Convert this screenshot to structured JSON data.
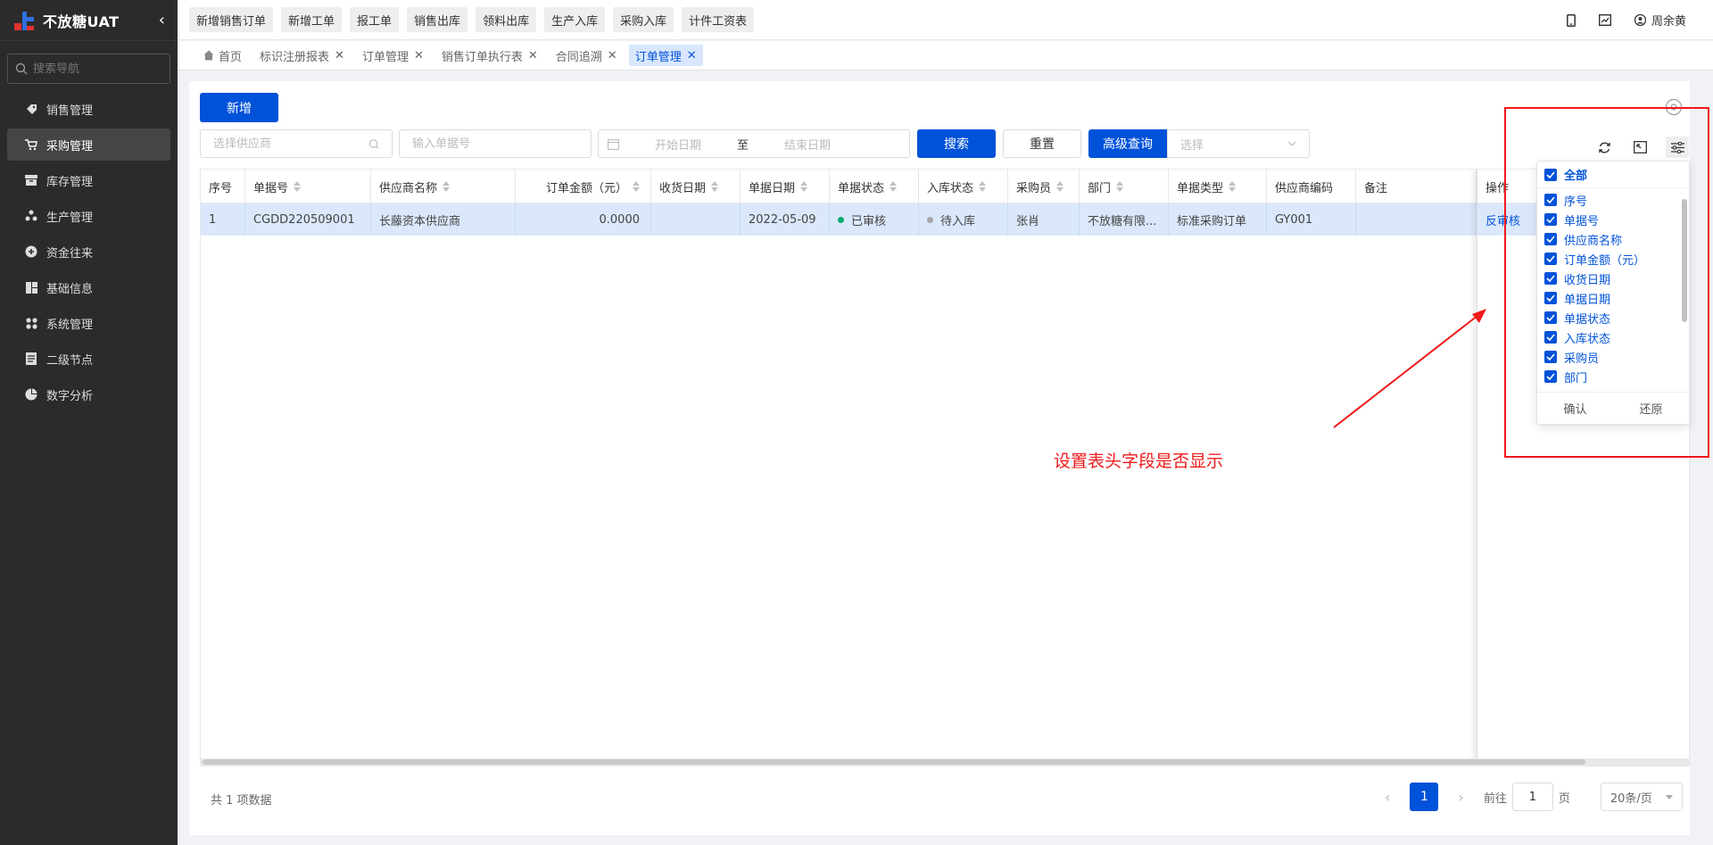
{
  "app": {
    "title": "不放糖UAT"
  },
  "sidebar": {
    "search_placeholder": "搜索导航",
    "items": [
      {
        "label": "销售管理",
        "icon": "tag-icon"
      },
      {
        "label": "采购管理",
        "icon": "cart-icon"
      },
      {
        "label": "库存管理",
        "icon": "inventory-icon"
      },
      {
        "label": "生产管理",
        "icon": "production-icon"
      },
      {
        "label": "资金往来",
        "icon": "fund-icon"
      },
      {
        "label": "基础信息",
        "icon": "chart-block-icon"
      },
      {
        "label": "系统管理",
        "icon": "apps-icon"
      },
      {
        "label": "二级节点",
        "icon": "doc-icon"
      },
      {
        "label": "数字分析",
        "icon": "pie-icon"
      }
    ]
  },
  "quick": [
    "新增销售订单",
    "新增工单",
    "报工单",
    "销售出库",
    "领料出库",
    "生产入库",
    "采购入库",
    "计件工资表"
  ],
  "user": {
    "name": "周余黄"
  },
  "tabs": [
    "首页",
    "标识注册报表",
    "订单管理",
    "销售订单执行表",
    "合同追溯",
    "订单管理"
  ],
  "toolbar": {
    "new_label": "新增",
    "supplier_placeholder": "选择供应商",
    "docno_placeholder": "输入单据号",
    "start_placeholder": "开始日期",
    "date_sep": "至",
    "end_placeholder": "结束日期",
    "search_label": "搜索",
    "reset_label": "重置",
    "advanced_label": "高级查询",
    "select_placeholder": "选择"
  },
  "table": {
    "columns": [
      "序号",
      "单据号",
      "供应商名称",
      "订单金额（元）",
      "收货日期",
      "单据日期",
      "单据状态",
      "入库状态",
      "采购员",
      "部门",
      "单据类型",
      "供应商编码",
      "备注",
      "操作"
    ],
    "rows": [
      {
        "seq": "1",
        "docno": "CGDD220509001",
        "supplier": "长藤资本供应商",
        "amount": "0.0000",
        "recv_date": "",
        "doc_date": "2022-05-09",
        "doc_status": "已审核",
        "stock_status": "待入库",
        "buyer": "张肖",
        "dept": "不放糖有限...",
        "doc_type": "标准采购订单",
        "supplier_code": "GY001",
        "remark": "",
        "action": "反审核"
      }
    ]
  },
  "footer": {
    "total": "共 1 项数据",
    "page": "1",
    "goto_prefix": "前往",
    "goto_value": "1",
    "goto_suffix": "页",
    "page_size": "20条/页"
  },
  "column_settings": {
    "all_label": "全部",
    "items": [
      "序号",
      "单据号",
      "供应商名称",
      "订单金额（元）",
      "收货日期",
      "单据日期",
      "单据状态",
      "入库状态",
      "采购员",
      "部门"
    ],
    "confirm_label": "确认",
    "restore_label": "还原"
  },
  "annotation": "设置表头字段是否显示",
  "colors": {
    "primary": "#0052d9",
    "sidebar_bg": "#2b2b2b",
    "annotation_red": "#f01a1a",
    "status_green": "#00a870",
    "status_gray": "#a6a6a6"
  }
}
